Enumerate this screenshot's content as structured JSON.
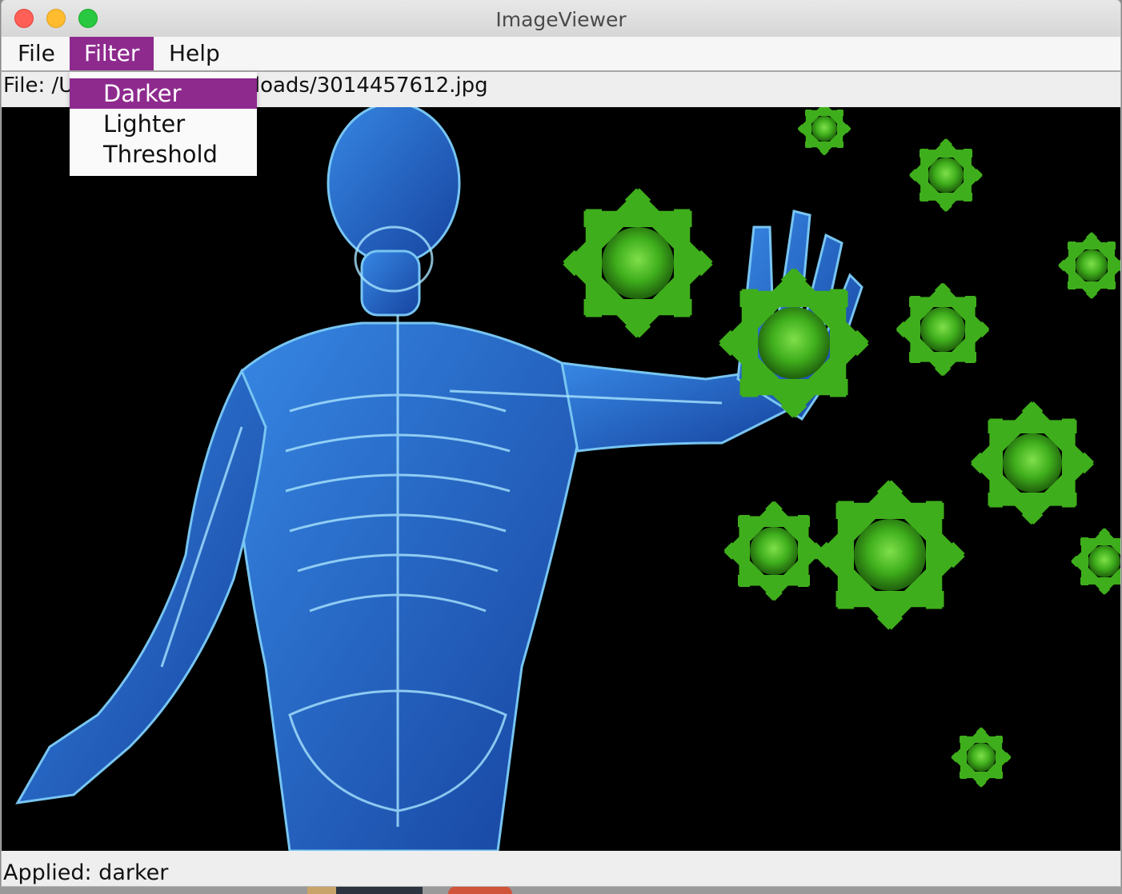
{
  "window": {
    "title": "ImageViewer"
  },
  "menubar": {
    "items": [
      "File",
      "Filter",
      "Help"
    ],
    "active": "Filter"
  },
  "pathbar": {
    "text": "File: /Users/chiara/Downloads/3014457612.jpg"
  },
  "filter_menu": {
    "items": [
      "Darker",
      "Lighter",
      "Threshold"
    ],
    "highlighted": "Darker"
  },
  "image": {
    "description_icon": "xray-skeleton-virus-image"
  },
  "status": {
    "text": "Applied: darker"
  },
  "colors": {
    "accent": "#8e2a8e",
    "canvas": "#000000",
    "bone": "#2f7fe0",
    "virus": "#3fae1c"
  }
}
